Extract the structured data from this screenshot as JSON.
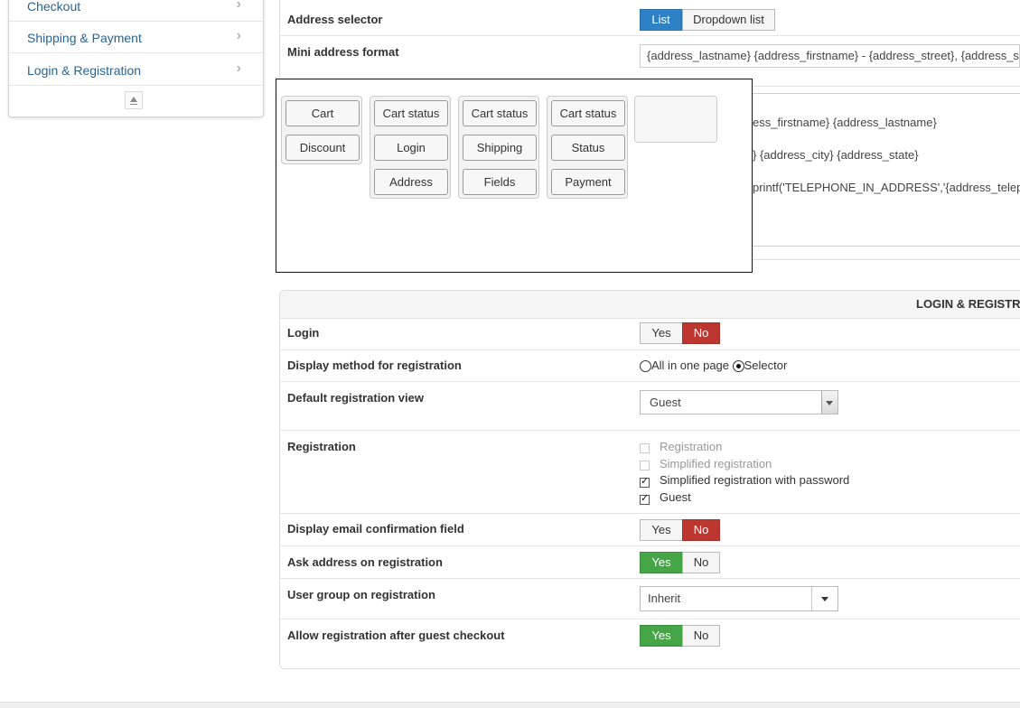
{
  "sidebar": {
    "items": [
      {
        "label": "Checkout"
      },
      {
        "label": "Shipping & Payment"
      },
      {
        "label": "Login & Registration"
      }
    ]
  },
  "address": {
    "selector_label": "Address selector",
    "selector_options": [
      "List",
      "Dropdown list"
    ],
    "selector_active": "List",
    "mini_format_label": "Mini address format",
    "mini_format_value": "{address_lastname} {address_firstname} - {address_street}, {address_st",
    "format_lines": [
      "ess_firstname} {address_lastname}",
      "} {address_city} {address_state}",
      "printf('TELEPHONE_IN_ADDRESS','{address_teleph"
    ]
  },
  "designer": {
    "columns": [
      {
        "buttons": [
          "Cart",
          "Discount"
        ]
      },
      {
        "buttons": [
          "Cart status",
          "Login",
          "Address"
        ]
      },
      {
        "buttons": [
          "Cart status",
          "Shipping",
          "Fields"
        ]
      },
      {
        "buttons": [
          "Cart status",
          "Status",
          "Payment"
        ]
      }
    ]
  },
  "login_panel": {
    "title": "LOGIN & REGISTR",
    "login": {
      "label": "Login",
      "yes": "Yes",
      "no": "No",
      "value": "No"
    },
    "display_method": {
      "label": "Display method for registration",
      "options": [
        "All in one page",
        "Selector"
      ],
      "selected": "Selector"
    },
    "default_view": {
      "label": "Default registration view",
      "value": "Guest"
    },
    "registration": {
      "label": "Registration",
      "options": [
        {
          "text": "Registration",
          "checked": false,
          "disabled": true
        },
        {
          "text": "Simplified registration",
          "checked": false,
          "disabled": true
        },
        {
          "text": "Simplified registration with password",
          "checked": true,
          "disabled": false
        },
        {
          "text": "Guest",
          "checked": true,
          "disabled": false
        }
      ]
    },
    "email_confirm": {
      "label": "Display email confirmation field",
      "yes": "Yes",
      "no": "No",
      "value": "No"
    },
    "ask_address": {
      "label": "Ask address on registration",
      "yes": "Yes",
      "no": "No",
      "value": "Yes"
    },
    "user_group": {
      "label": "User group on registration",
      "value": "Inherit"
    },
    "allow_after_guest": {
      "label": "Allow registration after guest checkout",
      "yes": "Yes",
      "no": "No",
      "value": "Yes"
    }
  },
  "colors": {
    "link": "#2a6496",
    "active_blue": "#2f81c5",
    "active_red": "#bd362f",
    "active_green": "#46a546"
  }
}
